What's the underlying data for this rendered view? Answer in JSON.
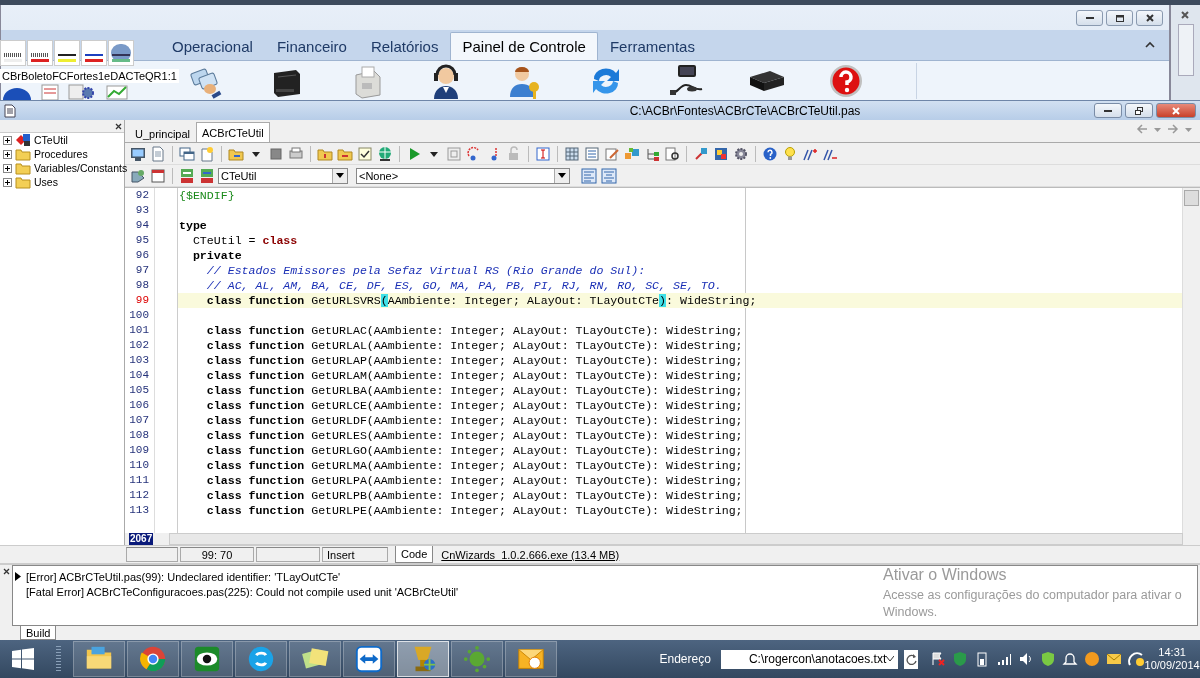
{
  "ribbon": {
    "tabs": [
      {
        "label": "Operacional",
        "selected": false
      },
      {
        "label": "Financeiro",
        "selected": false
      },
      {
        "label": "Relatórios",
        "selected": false
      },
      {
        "label": "Painel de Controle",
        "selected": true
      },
      {
        "label": "Ferramentas",
        "selected": false
      }
    ],
    "palette": {
      "caption": "CBrBoletoFCFortes1eDACTeQR1:1"
    }
  },
  "ide": {
    "title": "C:\\ACBr\\Fontes\\ACBrCTe\\ACBrCTeUtil.pas",
    "tree": [
      {
        "label": "CTeUtil",
        "kind": "unit",
        "expanded": false
      },
      {
        "label": "Procedures",
        "kind": "folder",
        "expanded": false
      },
      {
        "label": "Variables/Constants",
        "kind": "folder",
        "expanded": false
      },
      {
        "label": "Uses",
        "kind": "folder",
        "expanded": false
      }
    ],
    "editor_tabs": [
      {
        "label": "U_principal",
        "selected": false
      },
      {
        "label": "ACBrCTeUtil",
        "selected": true
      }
    ],
    "class_combo": {
      "value": "CTeUtil"
    },
    "method_combo": {
      "value": "<None>"
    },
    "lines": [
      {
        "number": "92",
        "current": false,
        "tokens": [
          {
            "kind": "directive",
            "text": "{$ENDIF}"
          }
        ]
      },
      {
        "number": "93",
        "current": false
      },
      {
        "number": "94",
        "current": false,
        "tokens": [
          {
            "kind": "keyword",
            "text": "type"
          }
        ]
      },
      {
        "number": "95",
        "current": false,
        "tokens": [
          {
            "kind": "text",
            "text": "  CTeUtil = "
          },
          {
            "kind": "reserved",
            "text": "class"
          }
        ]
      },
      {
        "number": "96",
        "current": false,
        "tokens": [
          {
            "kind": "keyword",
            "text": "  private"
          }
        ]
      },
      {
        "number": "97",
        "current": false,
        "tokens": [
          {
            "kind": "comment",
            "text": "    // Estados Emissores pela Sefaz Virtual RS (Rio Grande do Sul):"
          }
        ]
      },
      {
        "number": "98",
        "current": false,
        "tokens": [
          {
            "kind": "comment",
            "text": "    // AC, AL, AM, BA, CE, DF, ES, GO, MA, PA, PB, PI, RJ, RN, RO, SC, SE, TO."
          }
        ]
      },
      {
        "number": "99",
        "current": true,
        "tokens": [
          {
            "kind": "keyword",
            "text": "    class function"
          },
          {
            "kind": "text",
            "text": " GetURLSVRS"
          },
          {
            "kind": "match",
            "text": "("
          },
          {
            "kind": "text",
            "text": "AAmbiente: Integer; ALayOut: TLayOutCTe"
          },
          {
            "kind": "match",
            "text": ")"
          },
          {
            "kind": "text",
            "text": ": WideString;"
          }
        ]
      },
      {
        "number": "100",
        "current": false
      },
      {
        "number": "101",
        "current": false,
        "tokens": [
          {
            "kind": "keyword",
            "text": "    class function"
          },
          {
            "kind": "text",
            "text": " GetURLAC(AAmbiente: Integer; ALayOut: TLayOutCTe): WideString;"
          }
        ]
      },
      {
        "number": "102",
        "current": false,
        "tokens": [
          {
            "kind": "keyword",
            "text": "    class function"
          },
          {
            "kind": "text",
            "text": " GetURLAL(AAmbiente: Integer; ALayOut: TLayOutCTe): WideString;"
          }
        ]
      },
      {
        "number": "103",
        "current": false,
        "tokens": [
          {
            "kind": "keyword",
            "text": "    class function"
          },
          {
            "kind": "text",
            "text": " GetURLAP(AAmbiente: Integer; ALayOut: TLayOutCTe): WideString;"
          }
        ]
      },
      {
        "number": "104",
        "current": false,
        "tokens": [
          {
            "kind": "keyword",
            "text": "    class function"
          },
          {
            "kind": "text",
            "text": " GetURLAM(AAmbiente: Integer; ALayOut: TLayOutCTe): WideString;"
          }
        ]
      },
      {
        "number": "105",
        "current": false,
        "tokens": [
          {
            "kind": "keyword",
            "text": "    class function"
          },
          {
            "kind": "text",
            "text": " GetURLBA(AAmbiente: Integer; ALayOut: TLayOutCTe): WideString;"
          }
        ]
      },
      {
        "number": "106",
        "current": false,
        "tokens": [
          {
            "kind": "keyword",
            "text": "    class function"
          },
          {
            "kind": "text",
            "text": " GetURLCE(AAmbiente: Integer; ALayOut: TLayOutCTe): WideString;"
          }
        ]
      },
      {
        "number": "107",
        "current": false,
        "tokens": [
          {
            "kind": "keyword",
            "text": "    class function"
          },
          {
            "kind": "text",
            "text": " GetURLDF(AAmbiente: Integer; ALayOut: TLayOutCTe): WideString;"
          }
        ]
      },
      {
        "number": "108",
        "current": false,
        "tokens": [
          {
            "kind": "keyword",
            "text": "    class function"
          },
          {
            "kind": "text",
            "text": " GetURLES(AAmbiente: Integer; ALayOut: TLayOutCTe): WideString;"
          }
        ]
      },
      {
        "number": "109",
        "current": false,
        "tokens": [
          {
            "kind": "keyword",
            "text": "    class function"
          },
          {
            "kind": "text",
            "text": " GetURLGO(AAmbiente: Integer; ALayOut: TLayOutCTe): WideString;"
          }
        ]
      },
      {
        "number": "110",
        "current": false,
        "tokens": [
          {
            "kind": "keyword",
            "text": "    class function"
          },
          {
            "kind": "text",
            "text": " GetURLMA(AAmbiente: Integer; ALayOut: TLayOutCTe): WideString;"
          }
        ]
      },
      {
        "number": "111",
        "current": false,
        "tokens": [
          {
            "kind": "keyword",
            "text": "    class function"
          },
          {
            "kind": "text",
            "text": " GetURLPA(AAmbiente: Integer; ALayOut: TLayOutCTe): WideString;"
          }
        ]
      },
      {
        "number": "112",
        "current": false,
        "tokens": [
          {
            "kind": "keyword",
            "text": "    class function"
          },
          {
            "kind": "text",
            "text": " GetURLPB(AAmbiente: Integer; ALayOut: TLayOutCTe): WideString;"
          }
        ]
      },
      {
        "number": "113",
        "current": false,
        "tokens": [
          {
            "kind": "keyword",
            "text": "    class function"
          },
          {
            "kind": "text",
            "text": " GetURLPE(AAmbiente: Integer; ALayOut: TLayOutCTe): WideString;"
          }
        ]
      }
    ],
    "line_count": "2067",
    "status": {
      "position": "99: 70",
      "mode": "Insert",
      "view_tab": {
        "label": "Code",
        "selected": true
      },
      "memory": "CnWizards_1.0.2.666.exe (13.4 MB)"
    },
    "messages": [
      {
        "text": "[Error] ACBrCTeUtil.pas(99): Undeclared identifier: 'TLayOutCTe'",
        "selected": true
      },
      {
        "text": "[Fatal Error] ACBrCTeConfiguracoes.pas(225): Could not compile used unit 'ACBrCteUtil'",
        "selected": false
      }
    ],
    "message_tab": "Build"
  },
  "activation_notice": {
    "title": "Ativar o Windows",
    "text": "Acesse as configurações do computador para ativar o Windows."
  },
  "taskbar": {
    "apps": [
      {
        "kind": "folder",
        "active": false
      },
      {
        "kind": "ring",
        "active": false
      },
      {
        "kind": "eye",
        "active": false
      },
      {
        "kind": "bubble",
        "active": false
      },
      {
        "kind": "notes",
        "active": false
      },
      {
        "kind": "arrows",
        "active": false
      },
      {
        "kind": "trophy",
        "active": true
      },
      {
        "kind": "dots",
        "active": false
      },
      {
        "kind": "envelope",
        "active": false
      }
    ],
    "address_label": "Endereço",
    "address": "C:\\rogercon\\anotacoes.txt",
    "time": "14:31",
    "date": "10/09/2014"
  }
}
